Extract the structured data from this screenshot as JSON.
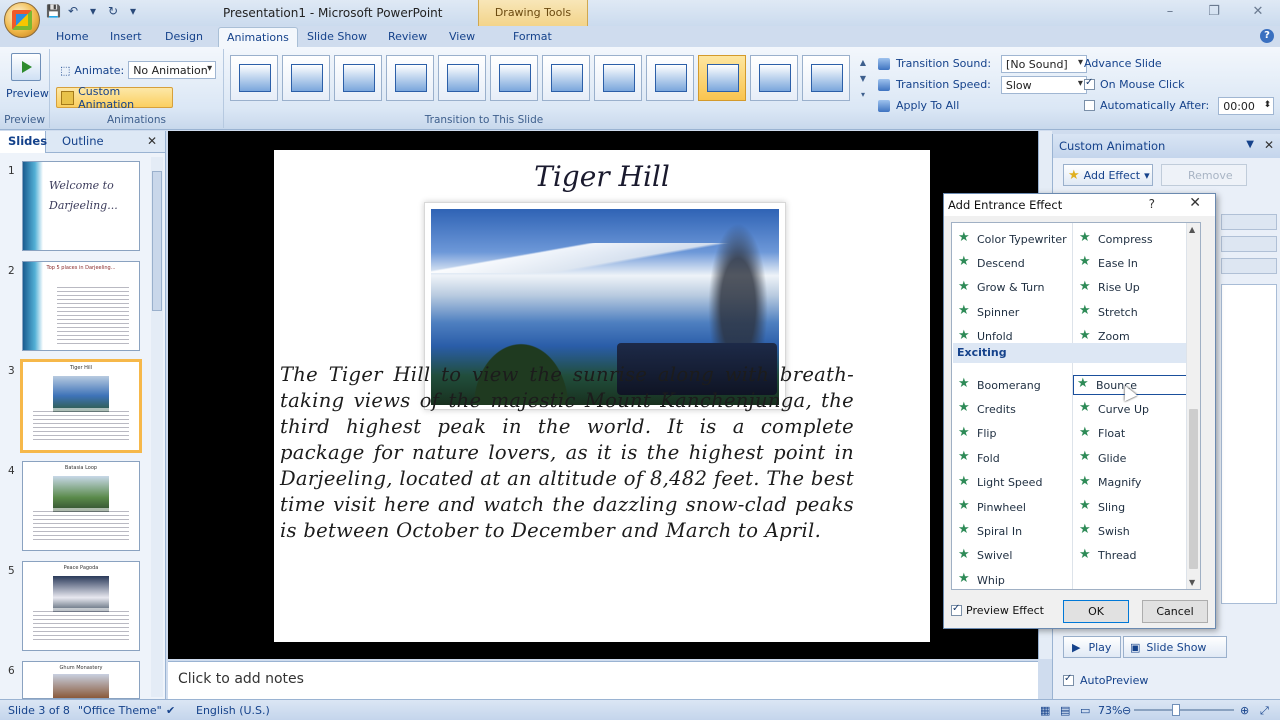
{
  "window": {
    "title": "Presentation1 - Microsoft PowerPoint",
    "contextual_tab": "Drawing Tools",
    "minimize": "–",
    "restore": "❐",
    "close": "✕"
  },
  "tabs": [
    "Home",
    "Insert",
    "Design",
    "Animations",
    "Slide Show",
    "Review",
    "View",
    "Format"
  ],
  "active_tab": "Animations",
  "ribbon": {
    "preview_label": "Preview",
    "preview_group": "Preview",
    "animate_label": "Animate:",
    "animate_value": "No Animation",
    "custom_animation": "Custom Animation",
    "animations_group": "Animations",
    "transition_group": "Transition to This Slide",
    "transition_sound_label": "Transition Sound:",
    "transition_sound_value": "[No Sound]",
    "transition_speed_label": "Transition Speed:",
    "transition_speed_value": "Slow",
    "apply_to_all": "Apply To All",
    "advance_title": "Advance Slide",
    "on_mouse_click": "On Mouse Click",
    "auto_after": "Automatically After:",
    "auto_after_value": "00:00"
  },
  "left_pane": {
    "tab_slides": "Slides",
    "tab_outline": "Outline",
    "close": "✕",
    "thumbs": [
      {
        "num": "1",
        "title": "Welcome to Darjeeling..."
      },
      {
        "num": "2",
        "title": "Top 5 places in Darjeeling..."
      },
      {
        "num": "3",
        "title": "Tiger Hill"
      },
      {
        "num": "4",
        "title": "Batasia Loop"
      },
      {
        "num": "5",
        "title": "Peace Pagoda"
      },
      {
        "num": "6",
        "title": "Ghum Monastery"
      }
    ]
  },
  "slide": {
    "title": "Tiger Hill",
    "body": "The Tiger Hill to view the sunrise along with breath-taking views of the majestic Mount Kanchenjunga, the third highest peak in the world. It is a complete package for nature lovers, as it is the highest point in Darjeeling, located at an altitude of 8,482 feet. The best time visit here and watch the dazzling snow-clad peaks is between October to December and March to April."
  },
  "notes_placeholder": "Click to add notes",
  "task_pane": {
    "title": "Custom Animation",
    "add_effect": "Add Effect",
    "remove": "Remove",
    "play": "Play",
    "slide_show": "Slide Show",
    "autopreview": "AutoPreview"
  },
  "dialog": {
    "title": "Add Entrance Effect",
    "help": "?",
    "close": "✕",
    "left_col_top": [
      "Color Typewriter",
      "Descend",
      "Grow & Turn",
      "Spinner",
      "Unfold"
    ],
    "right_col_top": [
      "Compress",
      "Ease In",
      "Rise Up",
      "Stretch",
      "Zoom"
    ],
    "category": "Exciting",
    "left_col_exciting": [
      "Boomerang",
      "Credits",
      "Flip",
      "Fold",
      "Light Speed",
      "Pinwheel",
      "Spiral In",
      "Swivel",
      "Whip"
    ],
    "right_col_exciting": [
      "Bounce",
      "Curve Up",
      "Float",
      "Glide",
      "Magnify",
      "Sling",
      "Swish",
      "Thread"
    ],
    "selected": "Bounce",
    "preview_effect": "Preview Effect",
    "ok": "OK",
    "cancel": "Cancel"
  },
  "status": {
    "slide_info": "Slide 3 of 8",
    "theme": "\"Office Theme\"",
    "language": "English (U.S.)",
    "zoom": "73%"
  }
}
